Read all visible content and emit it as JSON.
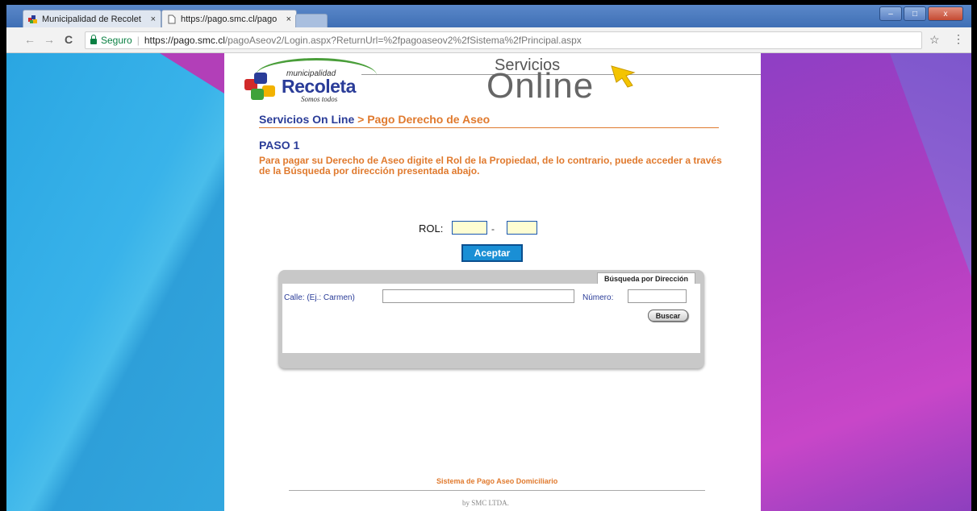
{
  "browser": {
    "tabs": [
      {
        "title": "Municipalidad de Recolet",
        "close": "×"
      },
      {
        "title": "https://pago.smc.cl/pago",
        "close": "×"
      }
    ],
    "security_label": "Seguro",
    "url_separator": "|",
    "url_host": "https://pago.smc.cl",
    "url_path": "/pagoAseov2/Login.aspx?ReturnUrl=%2fpagoaseov2%2fSistema%2fPrincipal.aspx",
    "icons": {
      "back": "←",
      "forward": "→",
      "reload": "C",
      "bookmark": "☆",
      "menu": "⋮"
    },
    "window_buttons": {
      "minimize": "–",
      "maximize": "□",
      "close": "x"
    }
  },
  "header": {
    "logo_small": "municipalidad",
    "logo_big": "Recoleta",
    "logo_tagline": "Somos todos",
    "servicios": "Servicios",
    "online": "Online"
  },
  "breadcrumb": {
    "root": "Servicios On Line",
    "current": " > Pago Derecho de Aseo"
  },
  "step": {
    "title": "PASO 1",
    "instructions": "Para pagar su Derecho de Aseo digite el Rol de la Propiedad, de lo contrario, puede acceder a través de la Búsqueda por dirección presentada abajo."
  },
  "rol_form": {
    "label": "ROL:",
    "separator": "-",
    "rol_value": "",
    "dv_value": "",
    "submit": "Aceptar"
  },
  "address_search": {
    "tab_label": "Búsqueda por Dirección",
    "street_label": "Calle: (Ej.: Carmen)",
    "street_value": "",
    "number_label": "Número:",
    "number_value": "",
    "search_button": "Buscar"
  },
  "footer": {
    "title": "Sistema de Pago Aseo Domiciliario",
    "credit": "by SMC LTDA."
  },
  "colors": {
    "brand_blue": "#2a3c98",
    "accent_orange": "#e07a2e",
    "button_blue": "#1a8fd5",
    "input_yellow": "#fefdd2"
  }
}
